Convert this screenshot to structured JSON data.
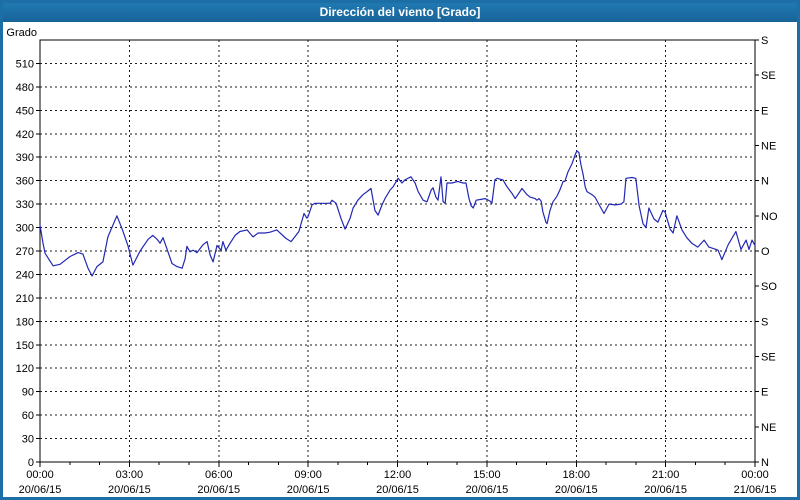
{
  "window": {
    "title": "Dirección del viento [Grado]"
  },
  "colors": {
    "frame": "#1b6ea6",
    "titlebar_text": "#ffffff",
    "plot_background": "#ffffff",
    "axis": "#000000",
    "grid": "#1a1a1a",
    "line": "#2328b4",
    "tick_text": "#000000"
  },
  "chart_data": {
    "type": "line",
    "title": "Dirección del viento [Grado]",
    "grid": true,
    "y_left": {
      "label": "Grado",
      "min": 0,
      "max": 540,
      "tick_step": 30,
      "ticks": [
        0,
        30,
        60,
        90,
        120,
        150,
        180,
        210,
        240,
        270,
        300,
        330,
        360,
        390,
        420,
        450,
        480,
        510
      ]
    },
    "y_right": {
      "ticks": [
        {
          "value": 0,
          "label": "N"
        },
        {
          "value": 45,
          "label": "NE"
        },
        {
          "value": 90,
          "label": "E"
        },
        {
          "value": 135,
          "label": "SE"
        },
        {
          "value": 180,
          "label": "S"
        },
        {
          "value": 225,
          "label": "SO"
        },
        {
          "value": 270,
          "label": "O"
        },
        {
          "value": 315,
          "label": "NO"
        },
        {
          "value": 360,
          "label": "N"
        },
        {
          "value": 405,
          "label": "NE"
        },
        {
          "value": 450,
          "label": "E"
        },
        {
          "value": 495,
          "label": "SE"
        },
        {
          "value": 540,
          "label": "S"
        }
      ]
    },
    "x": {
      "range_hours": [
        0,
        24
      ],
      "minor_tick_every_hours": 1,
      "major_ticks": [
        {
          "hour": 0,
          "time": "00:00",
          "date": "20/06/15"
        },
        {
          "hour": 3,
          "time": "03:00",
          "date": "20/06/15"
        },
        {
          "hour": 6,
          "time": "06:00",
          "date": "20/06/15"
        },
        {
          "hour": 9,
          "time": "09:00",
          "date": "20/06/15"
        },
        {
          "hour": 12,
          "time": "12:00",
          "date": "20/06/15"
        },
        {
          "hour": 15,
          "time": "15:00",
          "date": "20/06/15"
        },
        {
          "hour": 18,
          "time": "18:00",
          "date": "20/06/15"
        },
        {
          "hour": 21,
          "time": "21:00",
          "date": "20/06/15"
        },
        {
          "hour": 24,
          "time": "00:00",
          "date": "21/06/15"
        }
      ]
    },
    "series": [
      {
        "name": "Dirección del viento",
        "unit": "Grado",
        "points": [
          [
            0,
            303
          ],
          [
            0.1,
            280
          ],
          [
            0.17,
            267
          ],
          [
            0.34,
            257
          ],
          [
            0.44,
            251
          ],
          [
            0.67,
            253
          ],
          [
            1.01,
            263
          ],
          [
            1.28,
            268
          ],
          [
            1.44,
            266
          ],
          [
            1.61,
            248
          ],
          [
            1.75,
            238
          ],
          [
            1.91,
            250
          ],
          [
            2.11,
            256
          ],
          [
            2.28,
            288
          ],
          [
            2.58,
            315
          ],
          [
            2.75,
            299
          ],
          [
            2.95,
            277
          ],
          [
            3.12,
            252
          ],
          [
            3.36,
            270
          ],
          [
            3.63,
            285
          ],
          [
            3.79,
            290
          ],
          [
            3.93,
            285
          ],
          [
            4.03,
            280
          ],
          [
            4.13,
            287
          ],
          [
            4.26,
            273
          ],
          [
            4.43,
            254
          ],
          [
            4.6,
            250
          ],
          [
            4.77,
            248
          ],
          [
            4.87,
            260
          ],
          [
            4.93,
            276
          ],
          [
            5.03,
            269
          ],
          [
            5.14,
            271
          ],
          [
            5.27,
            268
          ],
          [
            5.47,
            278
          ],
          [
            5.61,
            282
          ],
          [
            5.71,
            265
          ],
          [
            5.81,
            256
          ],
          [
            5.94,
            277
          ],
          [
            6.08,
            271
          ],
          [
            6.14,
            282
          ],
          [
            6.24,
            271
          ],
          [
            6.38,
            280
          ],
          [
            6.55,
            290
          ],
          [
            6.71,
            295
          ],
          [
            6.95,
            297
          ],
          [
            7.15,
            288
          ],
          [
            7.32,
            293
          ],
          [
            7.55,
            293
          ],
          [
            7.72,
            294
          ],
          [
            7.95,
            297
          ],
          [
            8.26,
            286
          ],
          [
            8.43,
            282
          ],
          [
            8.69,
            295
          ],
          [
            8.86,
            318
          ],
          [
            8.96,
            312
          ],
          [
            9,
            314
          ],
          [
            9.13,
            329
          ],
          [
            9.23,
            331
          ],
          [
            9.73,
            331
          ],
          [
            9.8,
            335
          ],
          [
            9.94,
            331
          ],
          [
            10.1,
            312
          ],
          [
            10.24,
            298
          ],
          [
            10.41,
            312
          ],
          [
            10.51,
            325
          ],
          [
            10.67,
            335
          ],
          [
            10.84,
            342
          ],
          [
            10.98,
            346
          ],
          [
            11.11,
            350
          ],
          [
            11.24,
            322
          ],
          [
            11.35,
            316
          ],
          [
            11.48,
            329
          ],
          [
            11.58,
            337
          ],
          [
            11.75,
            348
          ],
          [
            11.85,
            352
          ],
          [
            12.02,
            363
          ],
          [
            12.15,
            357
          ],
          [
            12.25,
            361
          ],
          [
            12.45,
            365
          ],
          [
            12.59,
            357
          ],
          [
            12.69,
            346
          ],
          [
            12.86,
            335
          ],
          [
            12.99,
            333
          ],
          [
            13.13,
            348
          ],
          [
            13.19,
            351
          ],
          [
            13.29,
            339
          ],
          [
            13.36,
            335
          ],
          [
            13.46,
            365
          ],
          [
            13.53,
            333
          ],
          [
            13.6,
            331
          ],
          [
            13.66,
            357
          ],
          [
            13.83,
            357
          ],
          [
            14.03,
            359
          ],
          [
            14.2,
            357
          ],
          [
            14.3,
            357
          ],
          [
            14.4,
            337
          ],
          [
            14.47,
            328
          ],
          [
            14.54,
            325
          ],
          [
            14.64,
            335
          ],
          [
            14.8,
            336
          ],
          [
            14.94,
            337
          ],
          [
            15,
            336
          ],
          [
            15.1,
            334
          ],
          [
            15.17,
            331
          ],
          [
            15.27,
            361
          ],
          [
            15.34,
            363
          ],
          [
            15.54,
            361
          ],
          [
            15.68,
            352
          ],
          [
            15.84,
            344
          ],
          [
            15.95,
            337
          ],
          [
            16.18,
            350
          ],
          [
            16.35,
            342
          ],
          [
            16.45,
            339
          ],
          [
            16.62,
            337
          ],
          [
            16.68,
            335
          ],
          [
            16.75,
            337
          ],
          [
            16.82,
            334
          ],
          [
            16.88,
            320
          ],
          [
            16.98,
            307
          ],
          [
            17.02,
            305
          ],
          [
            17.12,
            322
          ],
          [
            17.22,
            333
          ],
          [
            17.35,
            340
          ],
          [
            17.45,
            348
          ],
          [
            17.56,
            359
          ],
          [
            17.62,
            359
          ],
          [
            17.72,
            371
          ],
          [
            17.86,
            382
          ],
          [
            17.96,
            393
          ],
          [
            18.02,
            398
          ],
          [
            18.09,
            396
          ],
          [
            18.12,
            389
          ],
          [
            18.16,
            380
          ],
          [
            18.23,
            368
          ],
          [
            18.3,
            352
          ],
          [
            18.36,
            346
          ],
          [
            18.53,
            342
          ],
          [
            18.63,
            339
          ],
          [
            18.8,
            327
          ],
          [
            18.93,
            318
          ],
          [
            19.1,
            330
          ],
          [
            19.3,
            329
          ],
          [
            19.5,
            330
          ],
          [
            19.6,
            333
          ],
          [
            19.67,
            363
          ],
          [
            19.87,
            364
          ],
          [
            20,
            363
          ],
          [
            20.11,
            328
          ],
          [
            20.24,
            305
          ],
          [
            20.34,
            300
          ],
          [
            20.44,
            325
          ],
          [
            20.61,
            311
          ],
          [
            20.74,
            307
          ],
          [
            20.91,
            322
          ],
          [
            20.98,
            320
          ],
          [
            21.15,
            298
          ],
          [
            21.25,
            293
          ],
          [
            21.38,
            315
          ],
          [
            21.55,
            297
          ],
          [
            21.71,
            287
          ],
          [
            21.88,
            280
          ],
          [
            22.08,
            275
          ],
          [
            22.29,
            284
          ],
          [
            22.45,
            275
          ],
          [
            22.62,
            273
          ],
          [
            22.76,
            271
          ],
          [
            22.89,
            259
          ],
          [
            23.1,
            278
          ],
          [
            23.36,
            295
          ],
          [
            23.53,
            272
          ],
          [
            23.7,
            284
          ],
          [
            23.8,
            272
          ],
          [
            23.9,
            284
          ],
          [
            24,
            277
          ]
        ]
      }
    ]
  }
}
